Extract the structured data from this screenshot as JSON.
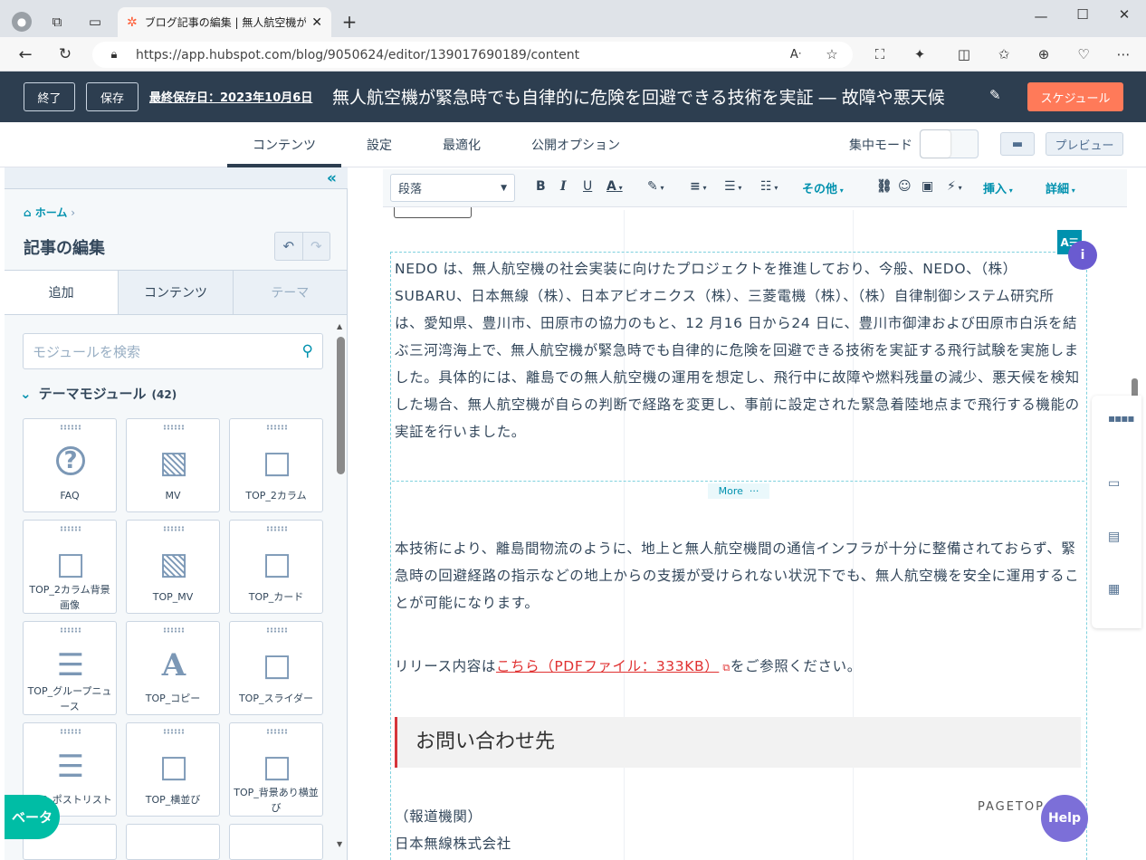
{
  "browser": {
    "tab_title": "ブログ記事の編集 | 無人航空機が緊",
    "url": "https://app.hubspot.com/blog/9050624/editor/139017690189/content"
  },
  "header": {
    "exit_label": "終了",
    "save_label": "保存",
    "last_saved": "最終保存日：2023年10月6日",
    "post_title": "無人航空機が緊急時でも自律的に危険を回避できる技術を実証 ― 故障や悪天候",
    "schedule_label": "スケジュール"
  },
  "nav": {
    "tabs": [
      "コンテンツ",
      "設定",
      "最適化",
      "公開オプション"
    ],
    "active": "コンテンツ",
    "focus_mode_label": "集中モード",
    "preview_label": "プレビュー"
  },
  "sidebar": {
    "breadcrumb": "ホーム",
    "title": "記事の編集",
    "tabs": [
      "追加",
      "コンテンツ",
      "テーマ"
    ],
    "search_placeholder": "モジュールを検索",
    "section_title": "テーマモジュール",
    "section_count": "(42)",
    "modules": [
      {
        "label": "FAQ",
        "icon": "question-icon"
      },
      {
        "label": "MV",
        "icon": "images-icon"
      },
      {
        "label": "TOP_2カラム",
        "icon": "square-icon"
      },
      {
        "label": "TOP_2カラム背景画像",
        "icon": "square-icon"
      },
      {
        "label": "TOP_MV",
        "icon": "images-icon"
      },
      {
        "label": "TOP_カード",
        "icon": "square-icon"
      },
      {
        "label": "TOP_グループニュース",
        "icon": "list-icon"
      },
      {
        "label": "TOP_コピー",
        "icon": "text-a-icon"
      },
      {
        "label": "TOP_スライダー",
        "icon": "square-icon"
      },
      {
        "label": "TOP_ポストリスト",
        "icon": "list-icon"
      },
      {
        "label": "TOP_横並び",
        "icon": "square-icon"
      },
      {
        "label": "TOP_背景あり横並び",
        "icon": "square-icon"
      }
    ],
    "beta_label": "ベータ"
  },
  "toolbar": {
    "paragraph": "段落",
    "more_label": "その他",
    "insert_label": "挿入",
    "advanced_label": "詳細"
  },
  "content": {
    "para1": "NEDO は、無人航空機の社会実装に向けたプロジェクトを推進しており、今般、NEDO、（株）SUBARU、日本無線（株）、日本アビオニクス（株）、三菱電機（株）、（株）自律制御システム研究所は、愛知県、豊川市、田原市の協力のもと、12 月16 日から24 日に、豊川市御津および田原市白浜を結ぶ三河湾海上で、無人航空機が緊急時でも自律的に危険を回避できる技術を実証する飛行試験を実施しました。具体的には、離島での無人航空機の運用を想定し、飛行中に故障や燃料残量の減少、悪天候を検知した場合、無人航空機が自らの判断で経路を変更し、事前に設定された緊急着陸地点まで飛行する機能の実証を行いました。",
    "more_label": "More",
    "para2": "本技術により、離島間物流のように、地上と無人航空機間の通信インフラが十分に整備されておらず、緊急時の回避経路の指示などの地上からの支援が受けられない状況下でも、無人航空機を安全に運用することが可能になります。",
    "para3_pre": "リリース内容は",
    "para3_link": "こちら（PDFファイル：333KB）",
    "para3_post": "をご参照ください。",
    "contact_heading": "お問い合わせ先",
    "press_label": "（報道機関）",
    "company": "日本無線株式会社",
    "pagetop": "PAGETOP"
  },
  "help_label": "Help",
  "colors": {
    "accent": "#ff7a59",
    "header": "#2d3e50",
    "teal": "#0091ae"
  }
}
